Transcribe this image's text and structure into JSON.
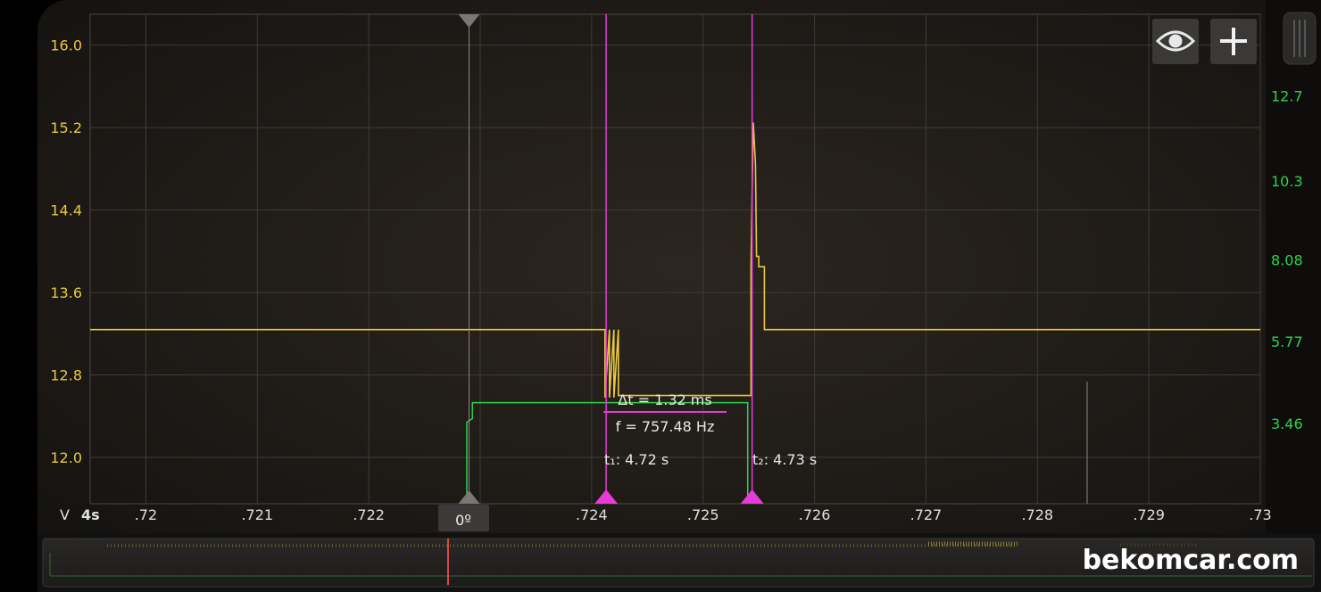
{
  "buttons": {
    "eye_icon": "eye-icon",
    "add_icon": "plus-icon"
  },
  "colors": {
    "ch1": "#e8c840",
    "ch2": "#2ed24a",
    "cursor": "#e83ad8",
    "axis_text": "#e0e0e0",
    "grid": "#3a3a3a"
  },
  "axis": {
    "v_unit": "V",
    "time_window": "4s",
    "trigger_label": "0º"
  },
  "measurement": {
    "delta_t": "Δt = 1.32 ms",
    "freq": "f = 757.48 Hz",
    "t1": "t₁: 4.72 s",
    "t2": "t₂: 4.73 s"
  },
  "watermark": "bekomcar.com",
  "chart_data": {
    "type": "line",
    "title": "",
    "xlabel": "",
    "ylabel": "V",
    "x_ticks": [
      ".72",
      ".721",
      ".722",
      ".723",
      ".724",
      ".725",
      ".726",
      ".727",
      ".728",
      ".729",
      ".73"
    ],
    "x_tick_values": [
      4.72,
      4.721,
      4.722,
      4.723,
      4.724,
      4.725,
      4.726,
      4.727,
      4.728,
      4.729,
      4.73
    ],
    "xlim": [
      4.7195,
      4.73
    ],
    "y_left_ticks": [
      "16.0",
      "15.2",
      "14.4",
      "13.6",
      "12.8",
      "12.0"
    ],
    "y_left_tick_values": [
      16.0,
      15.2,
      14.4,
      13.6,
      12.8,
      12.0
    ],
    "y_left_lim": [
      11.55,
      16.3
    ],
    "y_right_ticks": [
      "12.7",
      "10.3",
      "8.08",
      "5.77",
      "3.46"
    ],
    "y_right_tick_values": [
      12.7,
      10.3,
      8.08,
      5.77,
      3.46
    ],
    "y_right_lim": [
      1.2,
      15.0
    ],
    "grid": true,
    "cursors": [
      4.72413,
      4.72544
    ],
    "trigger_x": 4.7229,
    "series": [
      {
        "x": [
          4.7195,
          4.72412,
          4.72412,
          4.72416,
          4.72416,
          4.7242,
          4.7242,
          4.72424,
          4.72424,
          4.7243,
          4.7243,
          4.72543,
          4.72543,
          4.72545,
          4.72547,
          4.72548,
          4.7255,
          4.7255,
          4.72555,
          4.72555,
          4.73
        ],
        "y": [
          13.24,
          13.24,
          12.58,
          13.24,
          12.58,
          13.24,
          12.58,
          13.24,
          12.6,
          12.6,
          12.6,
          12.6,
          13.85,
          15.25,
          14.85,
          13.95,
          13.95,
          13.85,
          13.85,
          13.24,
          13.24
        ]
      },
      {
        "x": [
          4.72288,
          4.72288,
          4.72293,
          4.72293,
          4.7254,
          4.7254
        ],
        "y": [
          1.2,
          3.5,
          3.6,
          4.05,
          4.05,
          1.2
        ]
      }
    ]
  }
}
